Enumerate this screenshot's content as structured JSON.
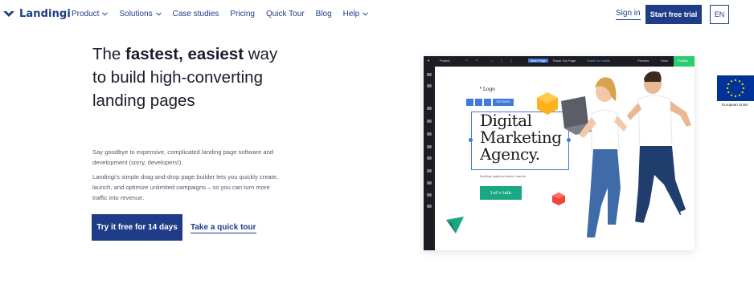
{
  "brand": {
    "name": "Landingi"
  },
  "nav": {
    "items": [
      {
        "label": "Product",
        "has_dropdown": true
      },
      {
        "label": "Solutions",
        "has_dropdown": true
      },
      {
        "label": "Case studies",
        "has_dropdown": false
      },
      {
        "label": "Pricing",
        "has_dropdown": false
      },
      {
        "label": "Quick Tour",
        "has_dropdown": false
      },
      {
        "label": "Blog",
        "has_dropdown": false
      },
      {
        "label": "Help",
        "has_dropdown": true
      }
    ],
    "sign_in": "Sign in",
    "start_trial": "Start free trial",
    "language": "EN"
  },
  "hero": {
    "headline_part1": "The ",
    "headline_bold": "fastest, easiest",
    "headline_part2": " way to build high-converting landing pages",
    "sub1": "Say goodbye to expensive, complicated landing page software and development (sorry, developers!).",
    "sub2": "Landingi's simple drag-and-drop page builder lets you quickly create, launch, and optimize unlimited campaigns – so you can turn more traffic into revenue.",
    "primary_cta": "Try it free for 14 days",
    "secondary_cta": "Take a quick tour"
  },
  "editor": {
    "topbar": {
      "project": "Project",
      "main_page": "Main Page",
      "thank_you": "Thank You Page",
      "switch_mobile": "Switch to mobile",
      "preview": "Preview",
      "save": "Save",
      "publish": "Publish"
    },
    "selection_label": "SETTINGS",
    "page": {
      "logo": "Logo",
      "title_line1": "Digital",
      "title_line2": "Marketing",
      "title_line3": "Agency.",
      "tagline": "Building digital products, brands",
      "button": "Let's talk"
    }
  },
  "eu_badge": {
    "label": "European Union"
  },
  "colors": {
    "brand_blue": "#1f3c88",
    "editor_dark": "#1c1c24",
    "publish_green": "#2ecc71",
    "teal_button": "#1aa884",
    "selection_blue": "#3f7ae0",
    "eu_blue": "#003399",
    "eu_star": "#ffcc00"
  }
}
